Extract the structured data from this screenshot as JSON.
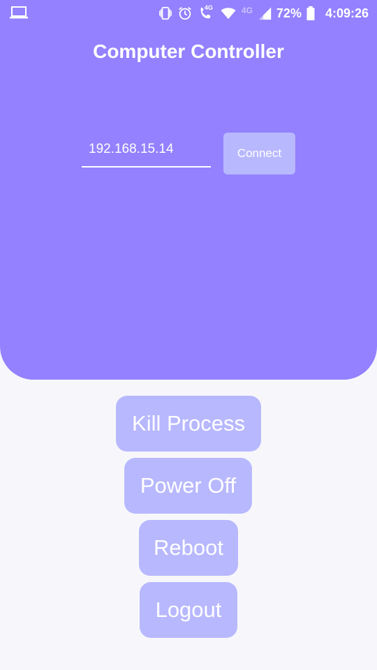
{
  "status_bar": {
    "icons": [
      "laptop-icon",
      "vibrate-icon",
      "alarm-icon",
      "volte-call-icon",
      "wifi-icon",
      "signal-icon",
      "battery-icon"
    ],
    "network_label_call": "4G",
    "network_label_faded": "4G",
    "battery": "72%",
    "time": "4:09:26"
  },
  "header": {
    "title": "Computer Controller"
  },
  "connection": {
    "ip_value": "192.168.15.14",
    "connect_label": "Connect"
  },
  "actions": {
    "kill_process": "Kill Process",
    "power_off": "Power Off",
    "reboot": "Reboot",
    "logout": "Logout"
  },
  "colors": {
    "header_bg": "#9381ff",
    "button_bg": "#b8b8ff",
    "page_bg": "#f7f7fb",
    "text": "#ffffff"
  }
}
